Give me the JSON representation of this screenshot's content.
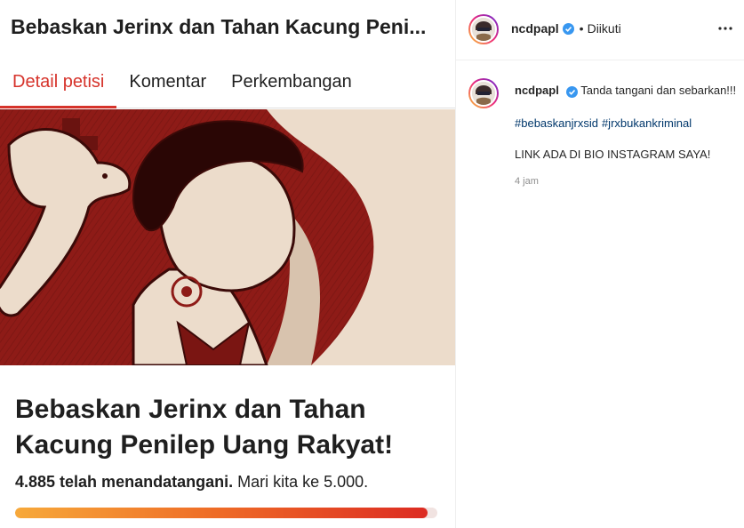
{
  "petition": {
    "header_title": "Bebaskan Jerinx dan Tahan Kacung Peni...",
    "tabs": [
      {
        "label": "Detail petisi",
        "active": true
      },
      {
        "label": "Komentar",
        "active": false
      },
      {
        "label": "Perkembangan",
        "active": false
      }
    ],
    "title": "Bebaskan Jerinx dan Tahan Kacung Penilep Uang Rakyat!",
    "signed_count": "4.885 telah menandatangani.",
    "goal_text": "Mari kita ke 5.000.",
    "progress_fraction": 0.977,
    "colors": {
      "accent": "#d6332b",
      "hero_bg": "#8e1b17",
      "hero_fg": "#ecdccb"
    }
  },
  "post": {
    "username": "ncdpapl",
    "verified_icon": "verified-badge-icon",
    "separator": "•",
    "follow_status": "Diikuti",
    "more_icon": "more-options-icon",
    "caption": {
      "username": "ncdpapl",
      "text": "Tanda tangani dan sebarkan!!!",
      "hashtags": [
        "#bebaskanjrxsid",
        "#jrxbukankriminal"
      ],
      "extra": "LINK ADA DI BIO INSTAGRAM SAYA!",
      "time": "4 jam"
    },
    "colors": {
      "verified": "#3897f0",
      "hashtag": "#00376b",
      "muted": "#8e8e8e"
    }
  }
}
